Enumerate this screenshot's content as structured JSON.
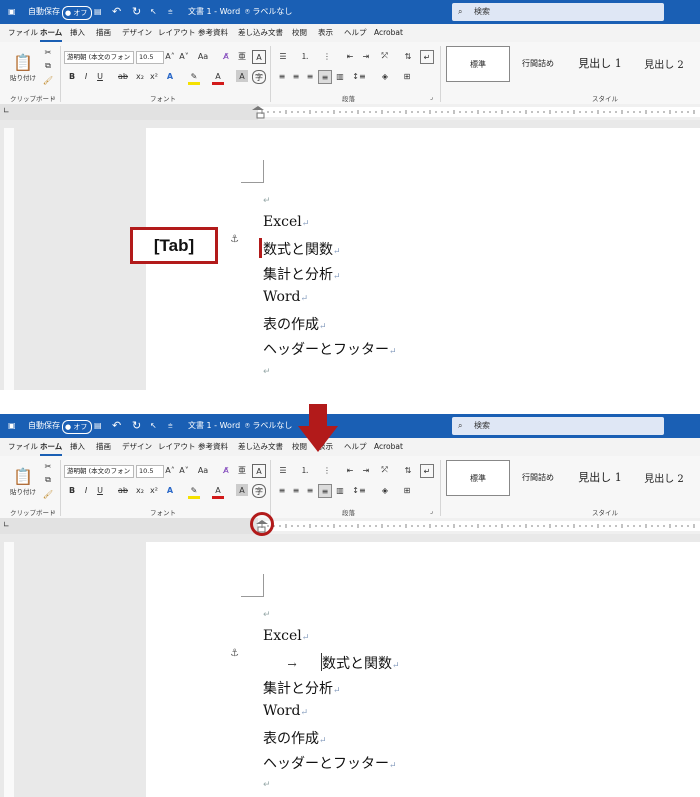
{
  "titlebar": {
    "autosave": "自動保存",
    "autosave_toggle": "オフ",
    "doc_title": "文書 1 - Word",
    "label_status": "ラベルなし",
    "search_placeholder": "検索"
  },
  "menu": [
    "ファイル",
    "ホーム",
    "挿入",
    "描画",
    "デザイン",
    "レイアウト",
    "参考資料",
    "差し込み文書",
    "校閲",
    "表示",
    "ヘルプ",
    "Acrobat"
  ],
  "ribbon": {
    "paste": "貼り付け",
    "font_name": "游明朝 (本文のフォン",
    "font_size": "10.5",
    "grow_font": "A˄",
    "shrink_font": "A˅",
    "case": "Aa",
    "bold": "B",
    "italic": "I",
    "underline": "U",
    "strike": "ab",
    "subscript": "x₂",
    "superscript": "x²",
    "highlight_letter": "A",
    "group_clipboard": "クリップボード",
    "group_font": "フォント",
    "group_paragraph": "段落",
    "group_styles": "スタイル",
    "styles": [
      "標準",
      "行間詰め",
      "見出し 1",
      "見出し 2"
    ]
  },
  "document_before": {
    "lines": [
      "Excel",
      "数式と関数",
      "集計と分析",
      "Word",
      "表の作成",
      "ヘッダーとフッター"
    ]
  },
  "document_after": {
    "lines": [
      "Excel",
      "数式と関数",
      "集計と分析",
      "Word",
      "表の作成",
      "ヘッダーとフッター"
    ],
    "tab_arrow": "→"
  },
  "callout": {
    "label": "[Tab]"
  },
  "colors": {
    "titlebar": "#1a5fb4",
    "annotation_red": "#b21a1a",
    "font_color_red": "#d21a1a",
    "highlight_yellow": "#f5e100"
  }
}
